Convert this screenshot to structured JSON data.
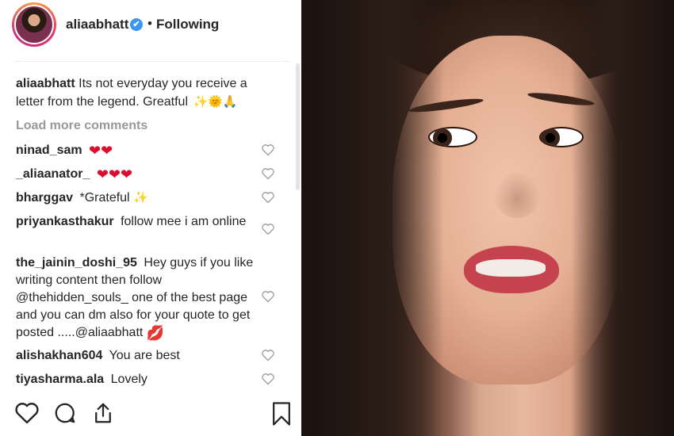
{
  "post": {
    "username": "aliaabhatt",
    "verified_mark": "✔",
    "separator": "•",
    "follow_status": "Following",
    "caption_user": "aliaabhatt",
    "caption_text": "Its not everyday you receive a letter from the legend. Greatful",
    "caption_emojis": "✨🌞🙏",
    "load_more": "Load more comments"
  },
  "comments": [
    {
      "user": "ninad_sam",
      "text": "",
      "hearts": "❤❤"
    },
    {
      "user": "_aliaanator_",
      "text": "",
      "hearts": "❤❤❤"
    },
    {
      "user": "bharggav",
      "text": "*Grateful",
      "hearts": "✨"
    },
    {
      "user": "priyankasthakur",
      "text": "follow mee i am online",
      "hearts": ""
    },
    {
      "user": "the_jainin_doshi_95",
      "text": "Hey guys if you like writing content then follow @thehidden_souls_ one of the best page and you can dm also for your quote to get posted .....@aliaabhatt",
      "hearts": "💋"
    },
    {
      "user": "alishakhan604",
      "text": "You are best",
      "hearts": ""
    },
    {
      "user": "tiyasharma.ala",
      "text": "Lovely",
      "hearts": ""
    }
  ],
  "icons": {
    "like": "heart-icon",
    "comment": "comment-icon",
    "share": "share-icon",
    "save": "bookmark-icon",
    "verified": "verified-badge-icon"
  },
  "colors": {
    "verified_blue": "#3897f0",
    "muted_text": "#999999",
    "heart_red": "#d8102e"
  }
}
